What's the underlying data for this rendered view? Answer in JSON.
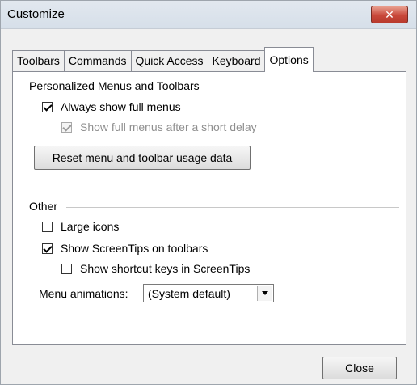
{
  "window": {
    "title": "Customize",
    "close_glyph": "✕"
  },
  "tabs": [
    {
      "label": "Toolbars"
    },
    {
      "label": "Commands"
    },
    {
      "label": "Quick Access"
    },
    {
      "label": "Keyboard"
    },
    {
      "label": "Options",
      "active": true
    }
  ],
  "personalized": {
    "group_label": "Personalized Menus and Toolbars",
    "always_show_full_menus": {
      "label": "Always show full menus",
      "checked": true,
      "enabled": true
    },
    "show_after_delay": {
      "label": "Show full menus after a short delay",
      "checked": true,
      "enabled": false
    },
    "reset_button": "Reset menu and toolbar usage data"
  },
  "other": {
    "group_label": "Other",
    "large_icons": {
      "label": "Large icons",
      "checked": false
    },
    "show_screentips": {
      "label": "Show ScreenTips on toolbars",
      "checked": true
    },
    "show_shortcut_keys": {
      "label": "Show shortcut keys in ScreenTips",
      "checked": false
    },
    "menu_animations_label": "Menu animations:",
    "menu_animations_value": "(System default)"
  },
  "footer": {
    "close_label": "Close"
  }
}
